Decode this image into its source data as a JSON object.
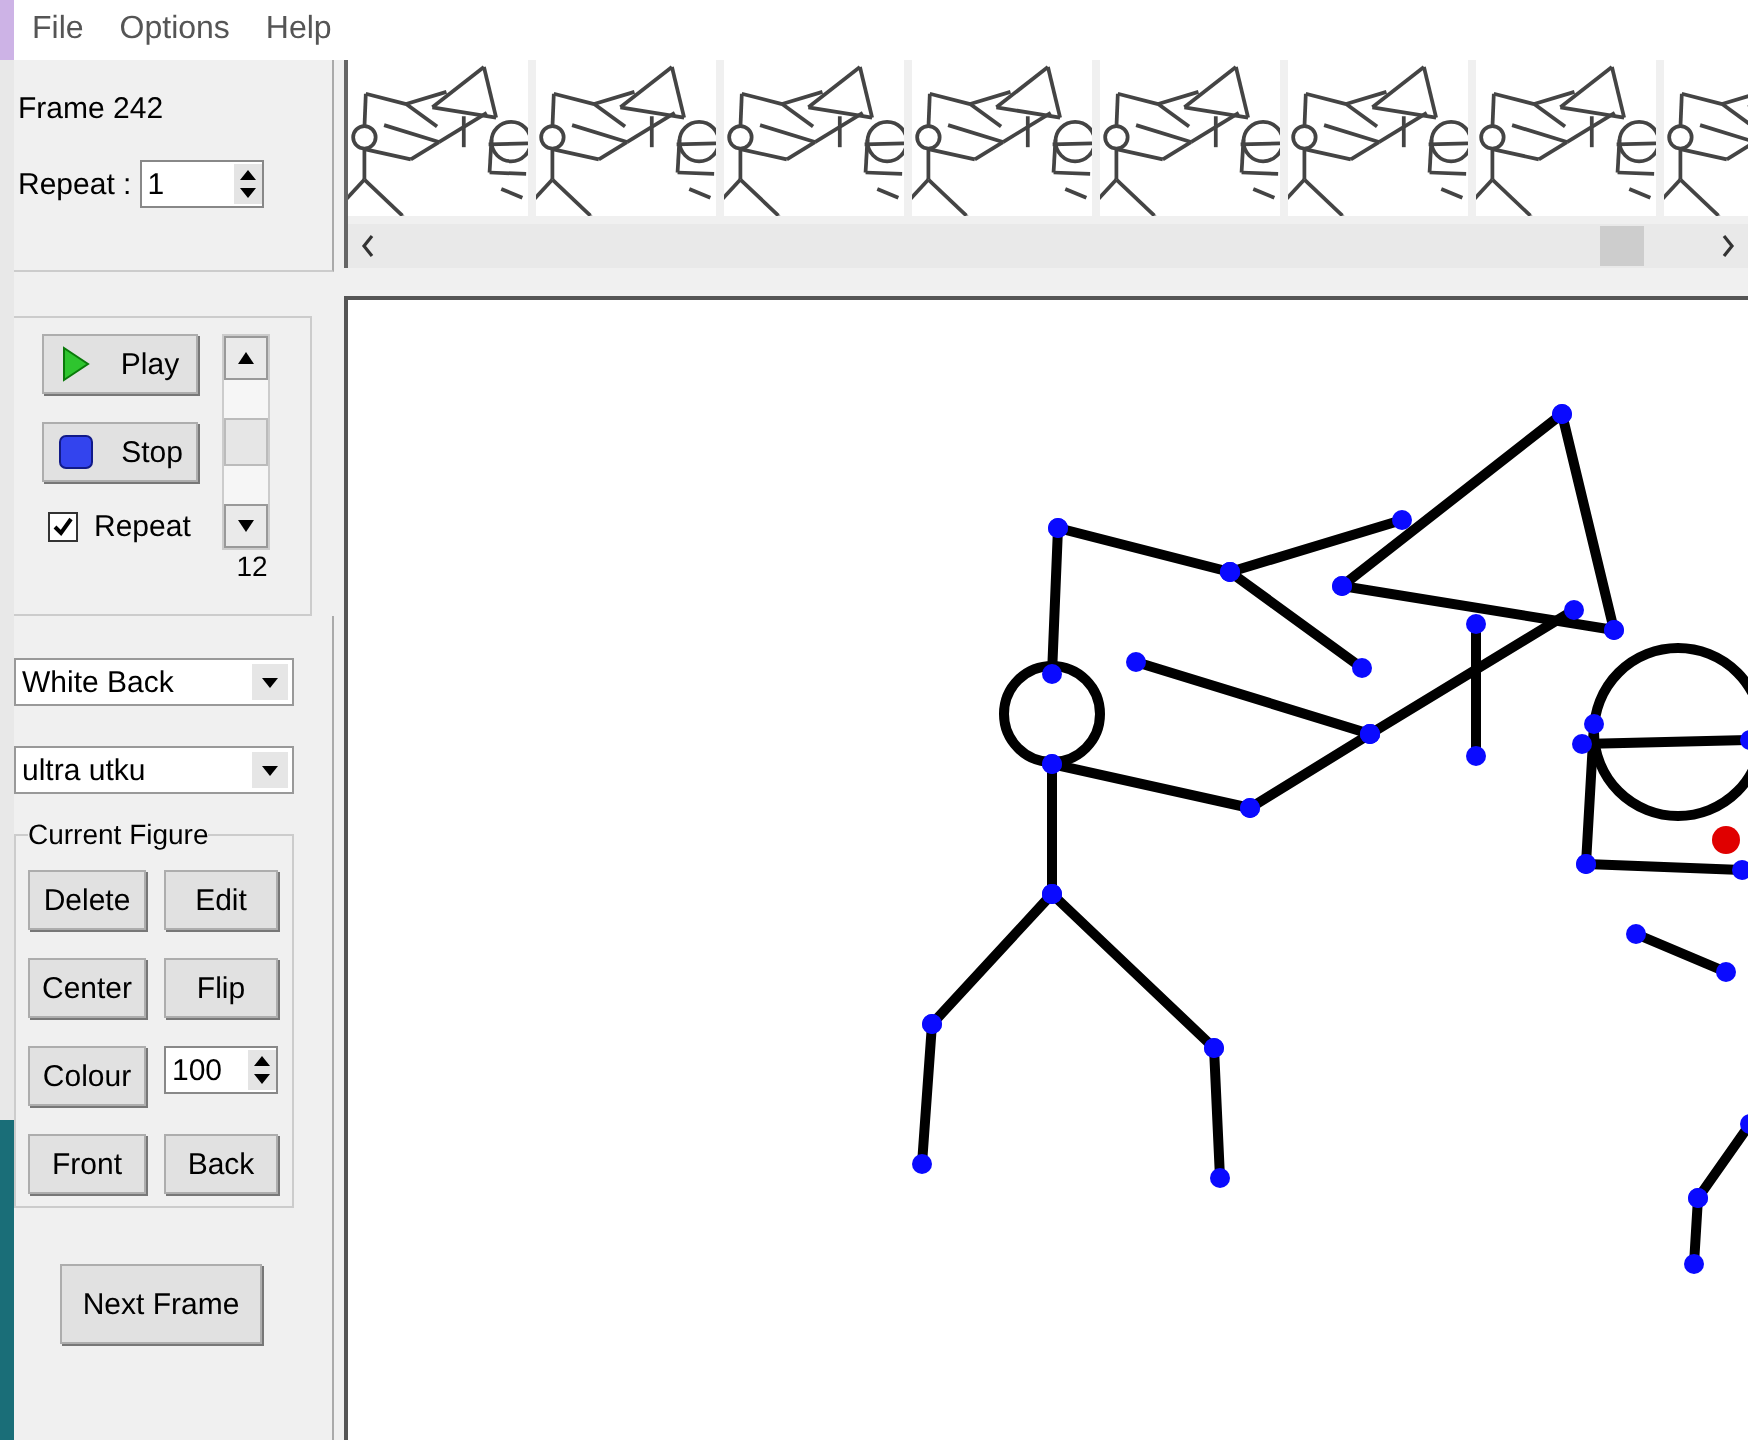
{
  "menu": [
    "File",
    "Options",
    "Help"
  ],
  "frame_label": "Frame 242",
  "repeat": {
    "label": "Repeat :",
    "value": "1"
  },
  "playback": [
    {
      "kind": "play",
      "label": "Play"
    },
    {
      "kind": "stop",
      "label": "Stop"
    }
  ],
  "loop": {
    "label": "Repeat",
    "checked": true
  },
  "speed": {
    "value": "12"
  },
  "background_select": {
    "value": "White Back"
  },
  "figure_select": {
    "value": "ultra utku"
  },
  "current_figure": {
    "title": "Current Figure",
    "controls": [
      {
        "kind": "button",
        "label": "Delete"
      },
      {
        "kind": "button",
        "label": "Edit"
      },
      {
        "kind": "button",
        "label": "Center"
      },
      {
        "kind": "button",
        "label": "Flip"
      },
      {
        "kind": "button",
        "label": "Colour"
      },
      {
        "kind": "spinner",
        "value": "100"
      },
      {
        "kind": "button",
        "label": "Front"
      },
      {
        "kind": "button",
        "label": "Back"
      }
    ]
  },
  "next_frame": "Next Frame"
}
